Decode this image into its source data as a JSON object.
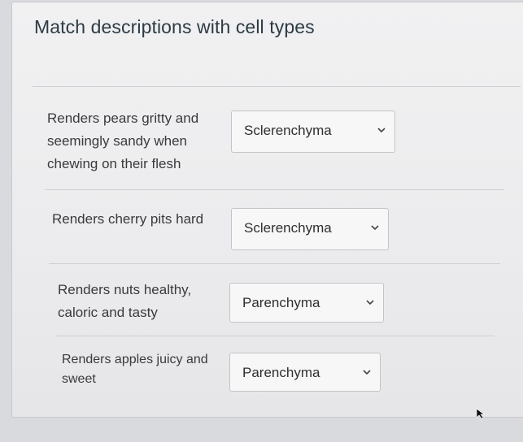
{
  "question": {
    "title": "Match descriptions with cell types"
  },
  "rows": [
    {
      "description_lines": [
        "Renders pears gritty and",
        "seemingly sandy when",
        "chewing on their flesh"
      ],
      "selected": "Sclerenchyma"
    },
    {
      "description_lines": [
        "Renders cherry pits hard"
      ],
      "selected": "Sclerenchyma"
    },
    {
      "description_lines": [
        "Renders nuts healthy,",
        "caloric and tasty"
      ],
      "selected": "Parenchyma"
    },
    {
      "description_lines": [
        "Renders apples juicy and",
        "sweet"
      ],
      "selected": "Parenchyma"
    }
  ],
  "icons": {
    "dropdown": "chevron-down-icon",
    "pointer": "mouse-cursor-icon"
  }
}
